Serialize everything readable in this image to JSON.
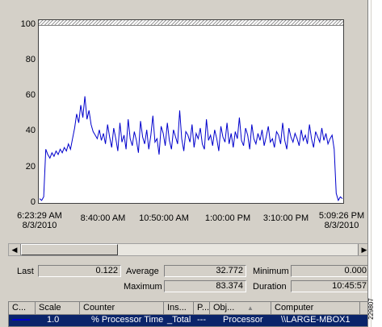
{
  "chart_data": {
    "type": "line",
    "ylim": [
      0,
      100
    ],
    "y_ticks": [
      "100",
      "80",
      "60",
      "40",
      "20",
      "0"
    ],
    "x_tick_labels": [
      {
        "line1": "6:23:29 AM",
        "line2": "8/3/2010"
      },
      {
        "line1": "8:40:00 AM",
        "line2": ""
      },
      {
        "line1": "10:50:00 AM",
        "line2": ""
      },
      {
        "line1": "1:00:00 PM",
        "line2": ""
      },
      {
        "line1": "3:10:00 PM",
        "line2": ""
      },
      {
        "line1": "5:09:26 PM",
        "line2": "8/3/2010"
      }
    ],
    "line_color": "#0000cc",
    "series": [
      {
        "values": [
          2,
          1,
          3,
          30,
          27,
          25,
          28,
          26,
          29,
          27,
          30,
          28,
          31,
          29,
          33,
          30,
          36,
          42,
          50,
          45,
          55,
          48,
          60,
          47,
          52,
          44,
          40,
          38,
          36,
          41,
          35,
          39,
          33,
          44,
          37,
          31,
          42,
          36,
          29,
          45,
          34,
          38,
          30,
          47,
          36,
          32,
          40,
          35,
          28,
          46,
          37,
          33,
          41,
          30,
          38,
          49,
          34,
          36,
          27,
          43,
          39,
          32,
          45,
          35,
          30,
          41,
          37,
          33,
          52,
          36,
          29,
          40,
          38,
          34,
          44,
          31,
          39,
          36,
          42,
          33,
          30,
          47,
          35,
          38,
          32,
          41,
          36,
          29,
          43,
          37,
          34,
          45,
          33,
          39,
          31,
          40,
          36,
          48,
          35,
          32,
          42,
          38,
          30,
          44,
          36,
          33,
          39,
          35,
          41,
          32,
          37,
          43,
          34,
          36,
          31,
          40,
          38,
          33,
          45,
          35,
          30,
          42,
          37,
          34,
          39,
          36,
          32,
          41,
          35,
          38,
          33,
          44,
          36,
          31,
          40,
          37,
          34,
          42,
          35,
          39,
          33,
          36,
          38,
          30,
          5,
          1,
          3,
          2
        ]
      }
    ]
  },
  "scrollbar": {
    "left_arrow": "◀",
    "right_arrow": "▶"
  },
  "stats": {
    "last_label": "Last",
    "last_value": "0.122",
    "average_label": "Average",
    "average_value": "32.772",
    "minimum_label": "Minimum",
    "minimum_value": "0.000",
    "maximum_label": "Maximum",
    "maximum_value": "83.374",
    "duration_label": "Duration",
    "duration_value": "10:45:57"
  },
  "counter_table": {
    "headers": [
      "C...",
      "Scale",
      "Counter",
      "Ins...",
      "P...",
      "Obj...",
      "Computer"
    ],
    "sort_indicator": "▲",
    "row": [
      "",
      "1.0",
      "% Processor Time",
      "_Total",
      "---",
      "Processor",
      "\\\\LARGE-MBOX1"
    ]
  },
  "side_text": "229807"
}
